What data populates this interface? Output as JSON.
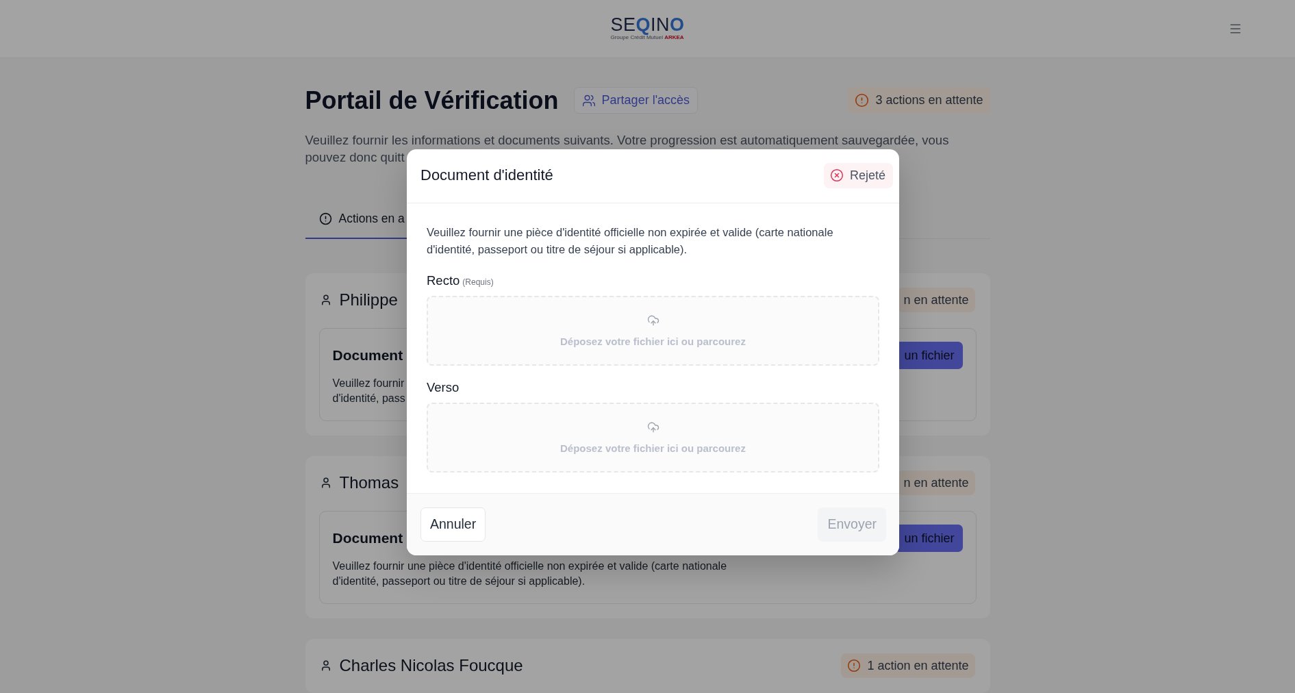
{
  "header": {
    "logo": {
      "parts": [
        {
          "text": "SE",
          "accent": false
        },
        {
          "text": "Q",
          "accent": true
        },
        {
          "text": "IN",
          "accent": false
        },
        {
          "text": "O",
          "accent": true
        }
      ],
      "tagline": "Groupe Crédit Mutuel **ARKEA**"
    }
  },
  "page": {
    "title": "Portail de Vérification",
    "share_button": "Partager l'accès",
    "pending_badge": "3 actions en attente",
    "intro": "Veuillez fournir les informations et documents suivants. Votre progression est automatiquement sauvegardée, vous pouvez donc quitt",
    "tabs": [
      {
        "label": "Actions en a",
        "selected": true
      }
    ]
  },
  "people": [
    {
      "name": "Philippe",
      "badge": {
        "label": "n en attente"
      },
      "documents": [
        {
          "title": "Document",
          "description_fragments": [
            "Veuillez fournir",
            "d'identité, pass"
          ],
          "button": "un fichier"
        }
      ]
    },
    {
      "name": "Thomas",
      "badge": {
        "label": "n en attente"
      },
      "documents": [
        {
          "title": "Document",
          "description": "Veuillez fournir une pièce d'identité officielle non expirée et valide (carte nationale d'identité, passeport ou titre de séjour si applicable).",
          "button": "un fichier"
        }
      ]
    },
    {
      "name": "Charles Nicolas Foucque",
      "badge": {
        "label": "1 action en attente",
        "alert_icon": true
      }
    }
  ],
  "modal": {
    "title": "Document d'identité",
    "status": {
      "label": "Rejeté",
      "kind": "rejected"
    },
    "description": "Veuillez fournir une pièce d'identité officielle non expirée et valide (carte nationale d'identité, passeport ou titre de séjour si applicable).",
    "uploads": [
      {
        "label": "Recto",
        "note": "(Requis)",
        "prompt": "Déposez votre fichier ici ou parcourez"
      },
      {
        "label": "Verso",
        "prompt": "Déposez votre fichier ici ou parcourez"
      }
    ],
    "cancel_button": "Annuler",
    "submit_button": {
      "label": "Envoyer",
      "disabled": true
    }
  }
}
